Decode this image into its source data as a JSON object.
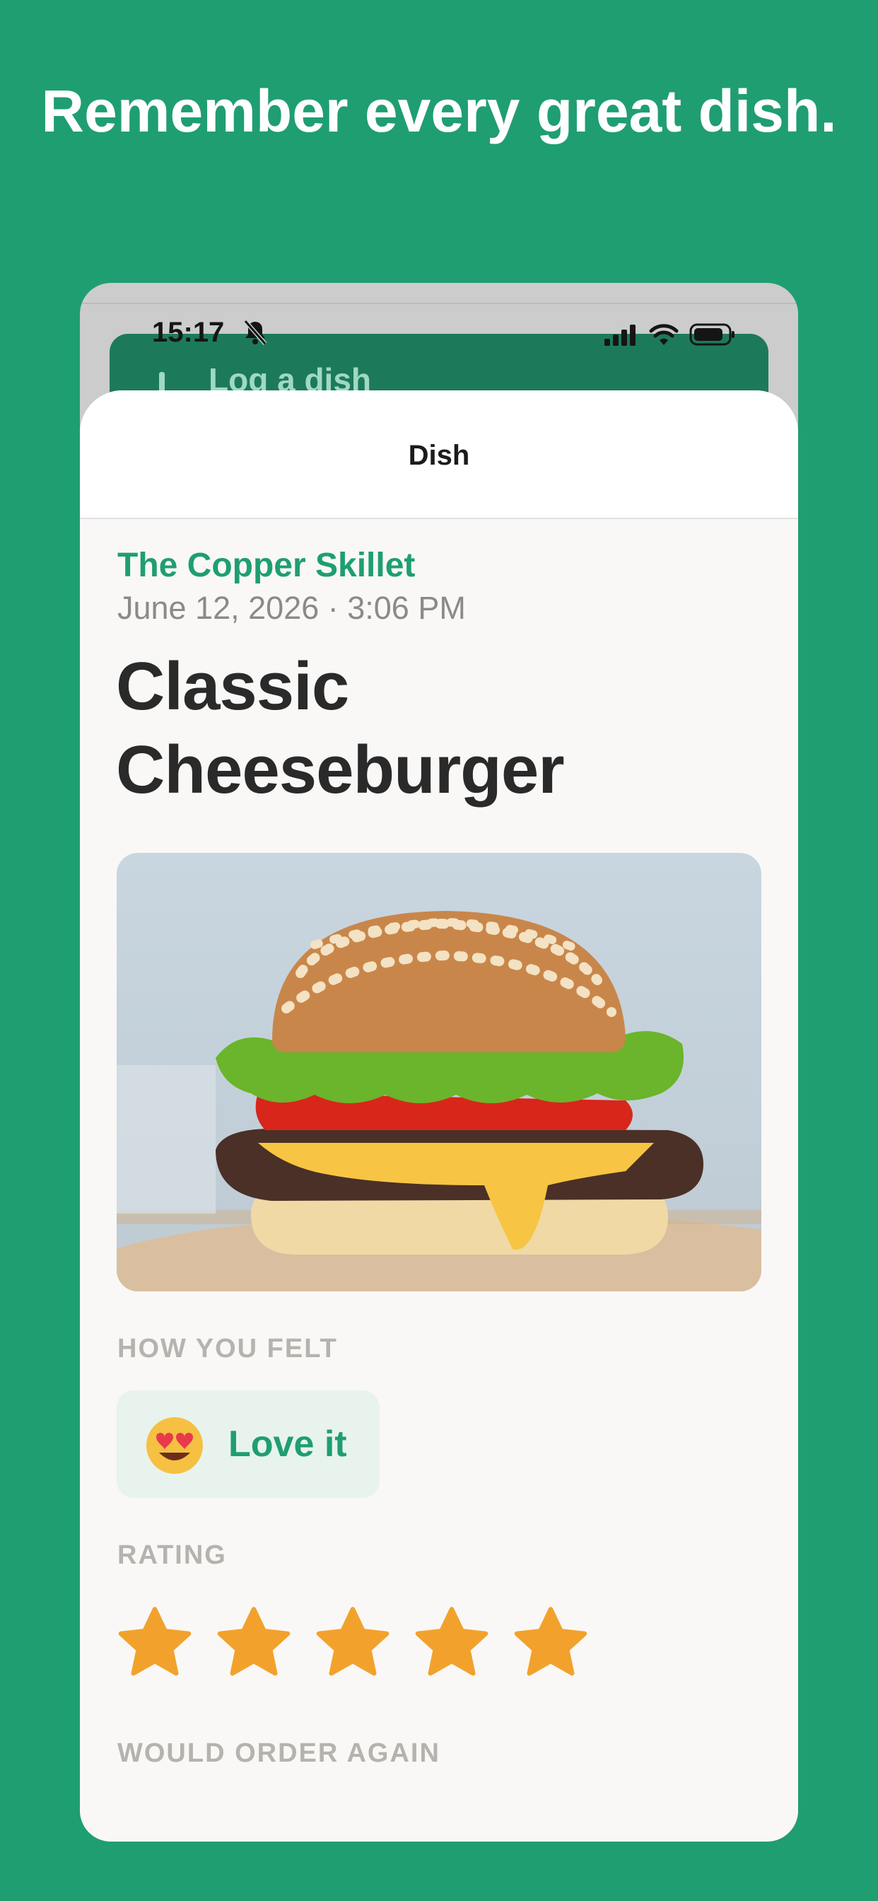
{
  "headline": "Remember every great dish.",
  "status_bar": {
    "time": "15:17",
    "icons": [
      "bell-slash-icon",
      "signal-icon",
      "wifi-icon",
      "battery-icon"
    ]
  },
  "background_screen": {
    "title": "Log a dish",
    "icon": "plus-icon"
  },
  "sheet": {
    "title": "Dish",
    "restaurant": "The Copper Skillet",
    "date_time": "June 12, 2026 · 3:06 PM",
    "dish_name": "Classic Cheeseburger",
    "photo": {
      "subject": "cheeseburger-photo"
    },
    "feeling": {
      "label": "HOW YOU FELT",
      "emoji_icon": "heart-eyes-emoji-icon",
      "text": "Love it"
    },
    "rating": {
      "label": "RATING",
      "value": 5,
      "max": 5
    },
    "order_again": {
      "label": "WOULD ORDER AGAIN"
    }
  },
  "colors": {
    "brand_green": "#1f9e72",
    "star_orange": "#f2a22c",
    "label_gray": "#b5b3ae"
  }
}
